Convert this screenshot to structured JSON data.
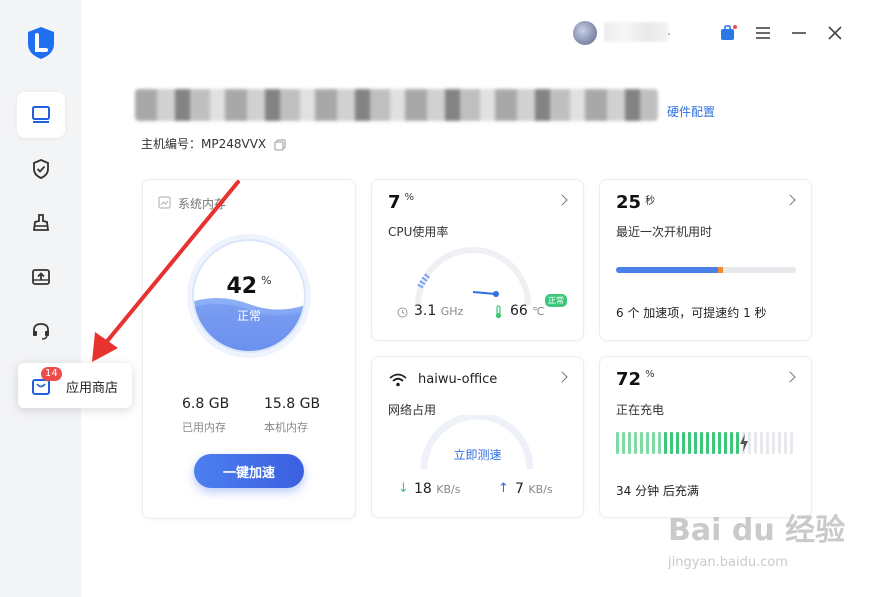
{
  "sidebar": {
    "store": {
      "label": "应用商店",
      "badge": "14"
    }
  },
  "topbar": {
    "dot": "."
  },
  "header": {
    "hardware_link": "硬件配置",
    "host_label": "主机编号：",
    "host_id": "MP248VVX"
  },
  "memory": {
    "title": "系统内存",
    "percent": "42",
    "percent_unit": "%",
    "state": "正常",
    "used_value": "6.8 GB",
    "used_label": "已用内存",
    "total_value": "15.8 GB",
    "total_label": "本机内存",
    "button": "一键加速"
  },
  "cpu": {
    "value": "7",
    "unit": "%",
    "label": "CPU使用率",
    "freq_value": "3.1",
    "freq_unit": "GHz",
    "temp_value": "66",
    "temp_unit": "℃",
    "temp_badge": "正常"
  },
  "boot": {
    "value": "25",
    "unit": "秒",
    "label": "最近一次开机用时",
    "tip": "6 个 加速项，可提速约 1 秒",
    "progress": 0.57
  },
  "network": {
    "ssid": "haiwu-office",
    "label": "网络占用",
    "test": "立即测速",
    "down_value": "18",
    "down_unit": "KB/s",
    "up_value": "7",
    "up_unit": "KB/s"
  },
  "battery": {
    "value": "72",
    "unit": "%",
    "label": "正在充电",
    "remain": "34 分钟 后充满",
    "level": 0.72
  },
  "watermark": {
    "line1": "Bai du 经验",
    "line2": "jingyan.baidu.com"
  },
  "colors": {
    "accent": "#3a6ff0",
    "green": "#3cc77a",
    "orange": "#f08a2b"
  }
}
